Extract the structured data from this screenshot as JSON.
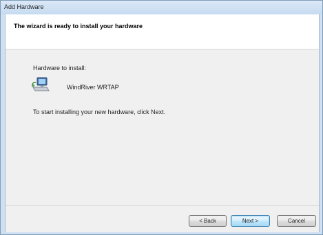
{
  "window": {
    "title": "Add Hardware"
  },
  "header": {
    "title": "The wizard is ready to install your hardware"
  },
  "body": {
    "hardware_label": "Hardware to install:",
    "device_icon": "network-adapter-icon",
    "device_name": "WindRiver WRTAP",
    "instruction": "To start installing your new hardware, click Next."
  },
  "buttons": {
    "back": "< Back",
    "next": "Next >",
    "cancel": "Cancel"
  }
}
